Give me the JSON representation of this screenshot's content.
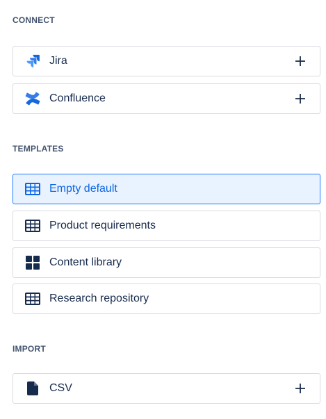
{
  "connect": {
    "heading": "CONNECT",
    "items": [
      {
        "label": "Jira",
        "icon": "jira-icon"
      },
      {
        "label": "Confluence",
        "icon": "confluence-icon"
      }
    ]
  },
  "templates": {
    "heading": "TEMPLATES",
    "items": [
      {
        "label": "Empty default",
        "icon": "table-icon",
        "selected": true
      },
      {
        "label": "Product requirements",
        "icon": "table-icon"
      },
      {
        "label": "Content library",
        "icon": "grid-icon"
      },
      {
        "label": "Research repository",
        "icon": "table-icon"
      }
    ]
  },
  "import": {
    "heading": "IMPORT",
    "items": [
      {
        "label": "CSV",
        "icon": "document-icon"
      }
    ]
  },
  "colors": {
    "accent": "#0c66e4",
    "selected_bg": "#e9f2ff",
    "icon_dark": "#172b4d",
    "jira_blue": "#1868db"
  }
}
